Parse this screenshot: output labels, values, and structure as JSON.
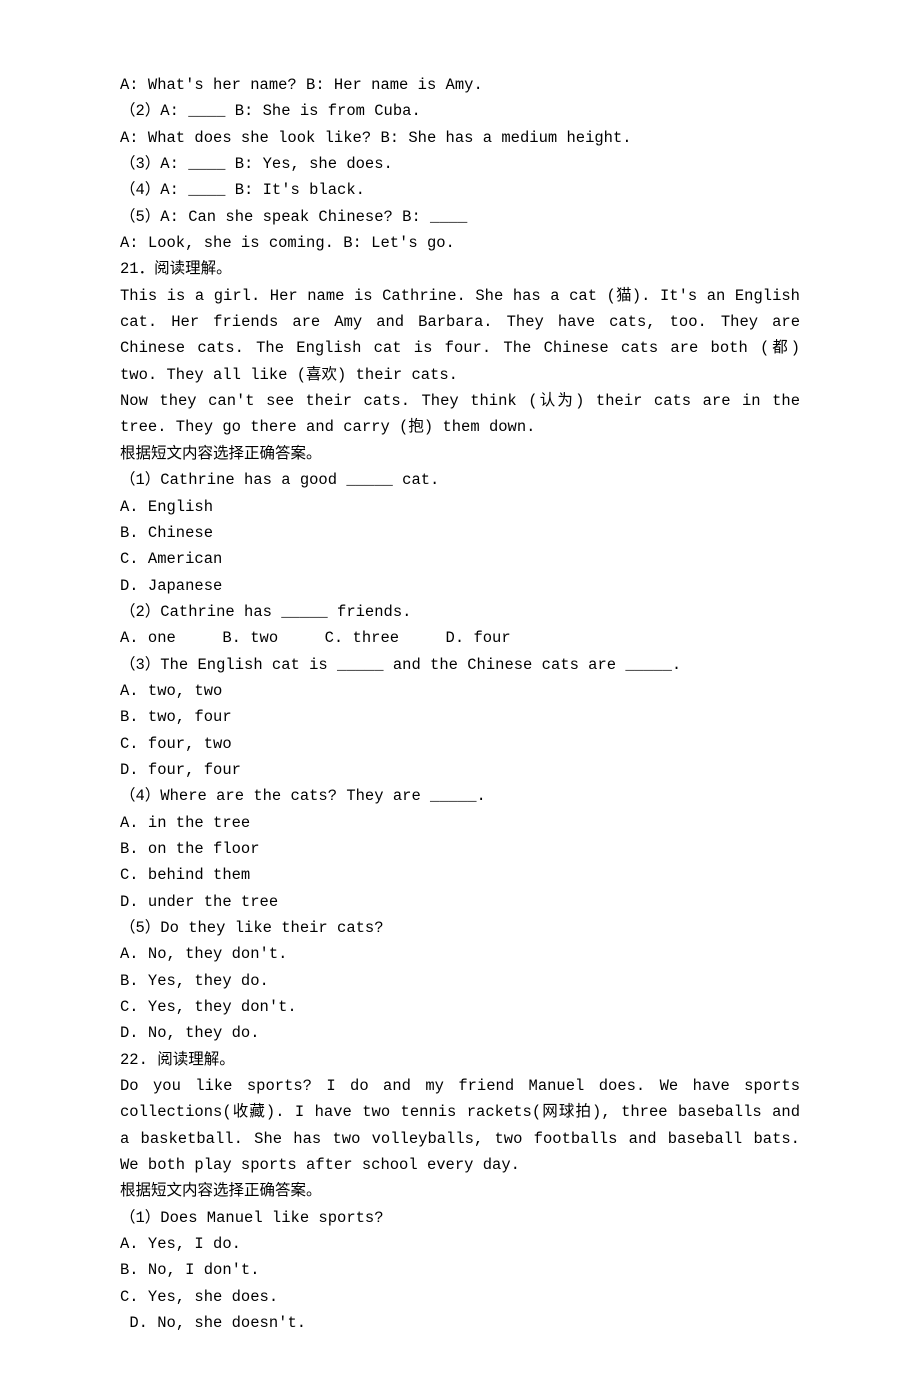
{
  "lines": [
    "A: What's her name? B: Her name is Amy.",
    "（2）A: ____ B: She is from Cuba.",
    "A: What does she look like? B: She has a medium height.",
    "（3）A: ____ B: Yes, she does.",
    "（4）A: ____ B: It's black.",
    "（5）A: Can she speak Chinese? B: ____",
    "A: Look, she is coming. B: Let's go.",
    "21．阅读理解。",
    "This is a girl. Her name is Cathrine. She has a cat (猫). It's an English cat. Her friends are Amy and Barbara. They have cats, too. They are Chinese cats. The English cat is four. The Chinese cats are both (都) two. They all like (喜欢) their cats.",
    "Now they can't see their cats. They think (认为) their cats are in the tree. They go there and carry (抱) them down.",
    "根据短文内容选择正确答案。",
    "（1）Cathrine has a good _____ cat.",
    "A. English",
    "B. Chinese",
    "C. American",
    "D. Japanese",
    "（2）Cathrine has _____ friends.",
    "A. one     B. two     C. three     D. four",
    "（3）The English cat is _____ and the Chinese cats are _____.",
    "A. two, two",
    "B. two, four",
    "C. four, two",
    "D. four, four",
    "（4）Where are the cats? They are _____.",
    "A. in the tree",
    "B. on the floor",
    "C. behind them",
    "D. under the tree",
    "（5）Do they like their cats?",
    "A. No, they don't.",
    "B. Yes, they do.",
    "C. Yes, they don't.",
    "D. No, they do.",
    "22. 阅读理解。",
    "Do you like sports? I do and my friend Manuel does. We have sports collections(收藏). I have two tennis rackets(网球拍), three baseballs and a basketball. She has two volleyballs, two footballs and baseball bats. We both play sports after school every day.",
    "根据短文内容选择正确答案。",
    "（1）Does Manuel like sports?",
    "A. Yes, I do.",
    "B. No, I don't.",
    "C. Yes, she does.",
    " D. No, she doesn't."
  ]
}
